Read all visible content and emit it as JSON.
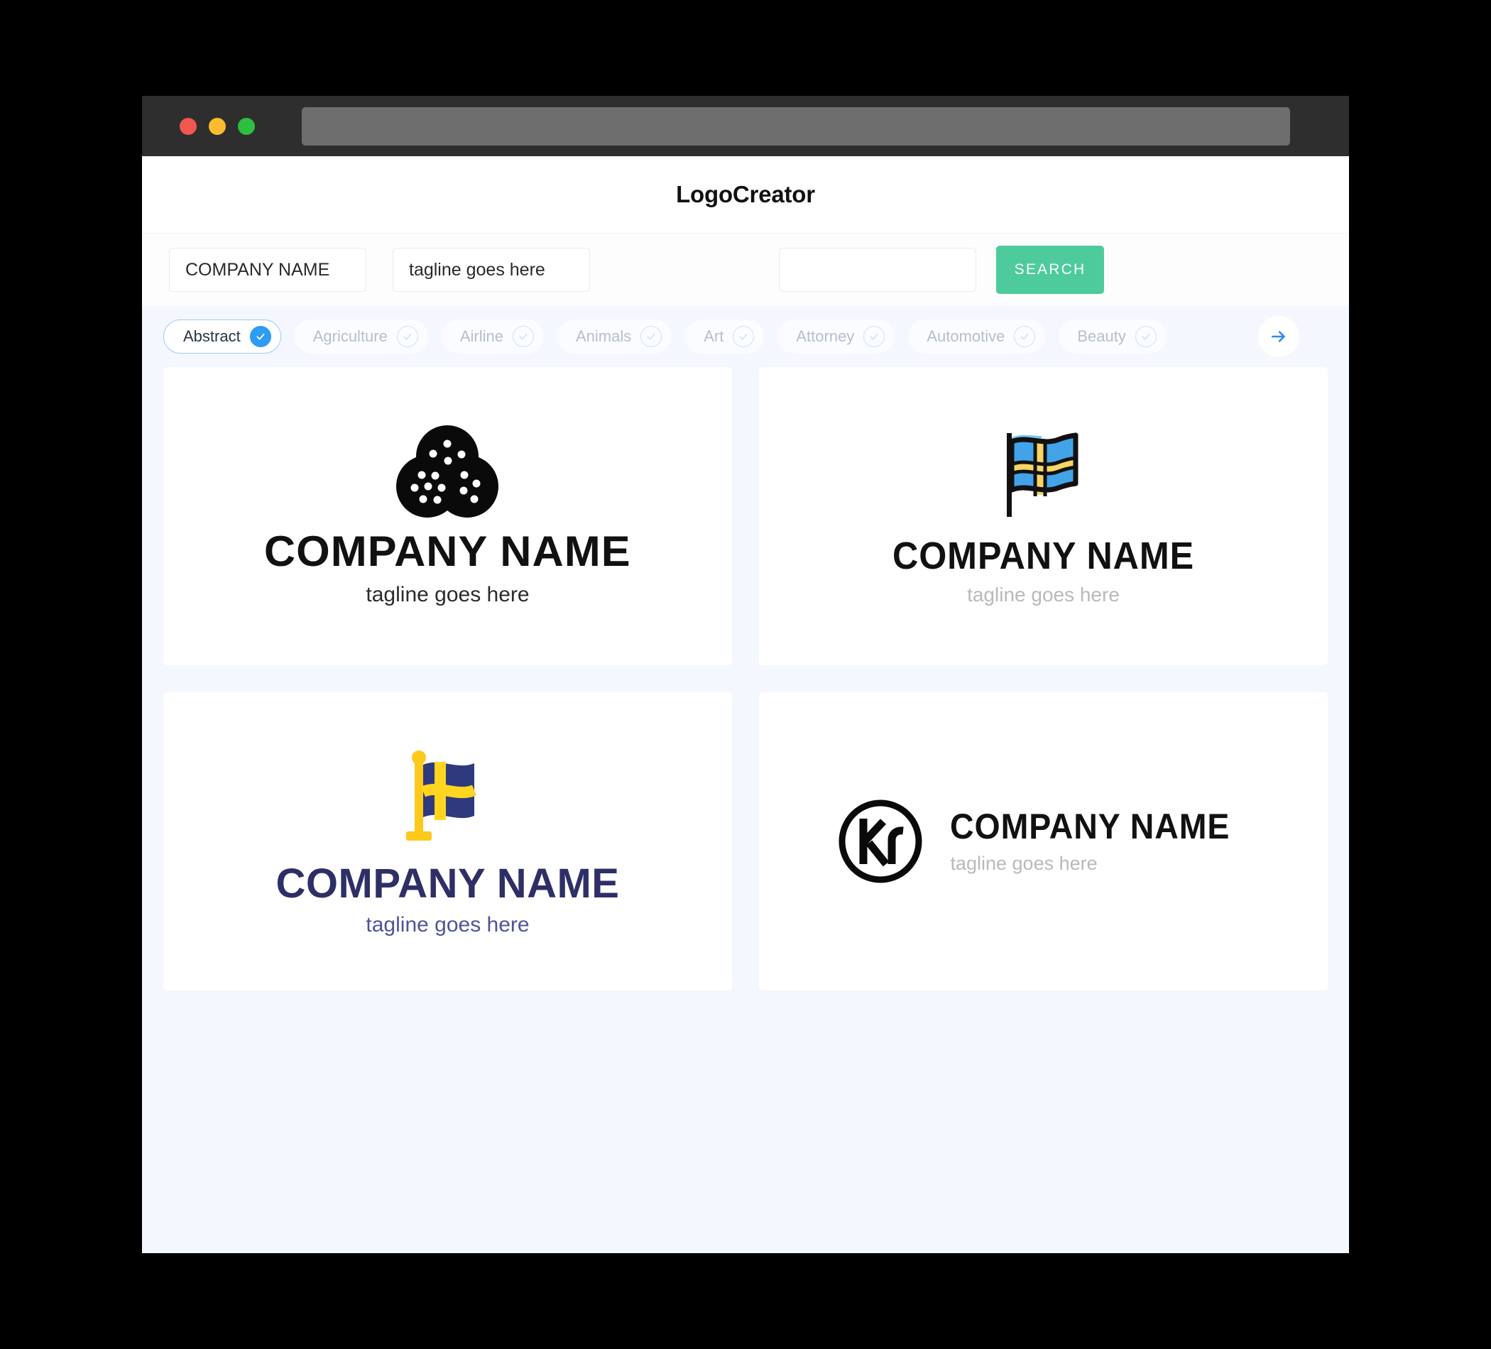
{
  "window": {
    "traffic_lights": [
      "close",
      "minimize",
      "maximize"
    ],
    "url_value": ""
  },
  "header": {
    "title": "LogoCreator"
  },
  "search": {
    "company_name_value": "COMPANY NAME",
    "company_name_placeholder": "COMPANY NAME",
    "tagline_value": "tagline goes here",
    "tagline_placeholder": "tagline goes here",
    "keyword_value": "",
    "keyword_placeholder": "",
    "search_label": "SEARCH"
  },
  "categories": {
    "items": [
      {
        "label": "Abstract",
        "selected": true
      },
      {
        "label": "Agriculture",
        "selected": false
      },
      {
        "label": "Airline",
        "selected": false
      },
      {
        "label": "Animals",
        "selected": false
      },
      {
        "label": "Art",
        "selected": false
      },
      {
        "label": "Attorney",
        "selected": false
      },
      {
        "label": "Automotive",
        "selected": false
      },
      {
        "label": "Beauty",
        "selected": false
      }
    ],
    "next_label": "next"
  },
  "results": {
    "cards": [
      {
        "icon": "three-dotted-circles-icon",
        "name": "COMPANY NAME",
        "tagline": "tagline goes here",
        "name_color": "#111111",
        "tagline_color": "#2B2B2B",
        "layout": "stacked"
      },
      {
        "icon": "outlined-swedish-flag-icon",
        "name": "COMPANY NAME",
        "tagline": "tagline goes here",
        "name_color": "#111111",
        "tagline_color": "#B9B9B9",
        "layout": "stacked"
      },
      {
        "icon": "flat-swedish-flag-icon",
        "name": "COMPANY NAME",
        "tagline": "tagline goes here",
        "name_color": "#2E2F66",
        "tagline_color": "#50539B",
        "layout": "stacked"
      },
      {
        "icon": "kr-circle-monogram-icon",
        "name": "COMPANY NAME",
        "tagline": "tagline goes here",
        "name_color": "#111111",
        "tagline_color": "#B9B9B9",
        "layout": "horizontal"
      }
    ]
  },
  "colors": {
    "accent_green": "#4ECB9C",
    "accent_blue": "#2E9BF5",
    "page_background": "#F4F7FD",
    "chrome": "#2E2E2E",
    "flag_blue": "#43A3E8",
    "flag_gold": "#F5D565",
    "flag_navy": "#2E3A7D",
    "flag_yellow": "#FFD520"
  }
}
